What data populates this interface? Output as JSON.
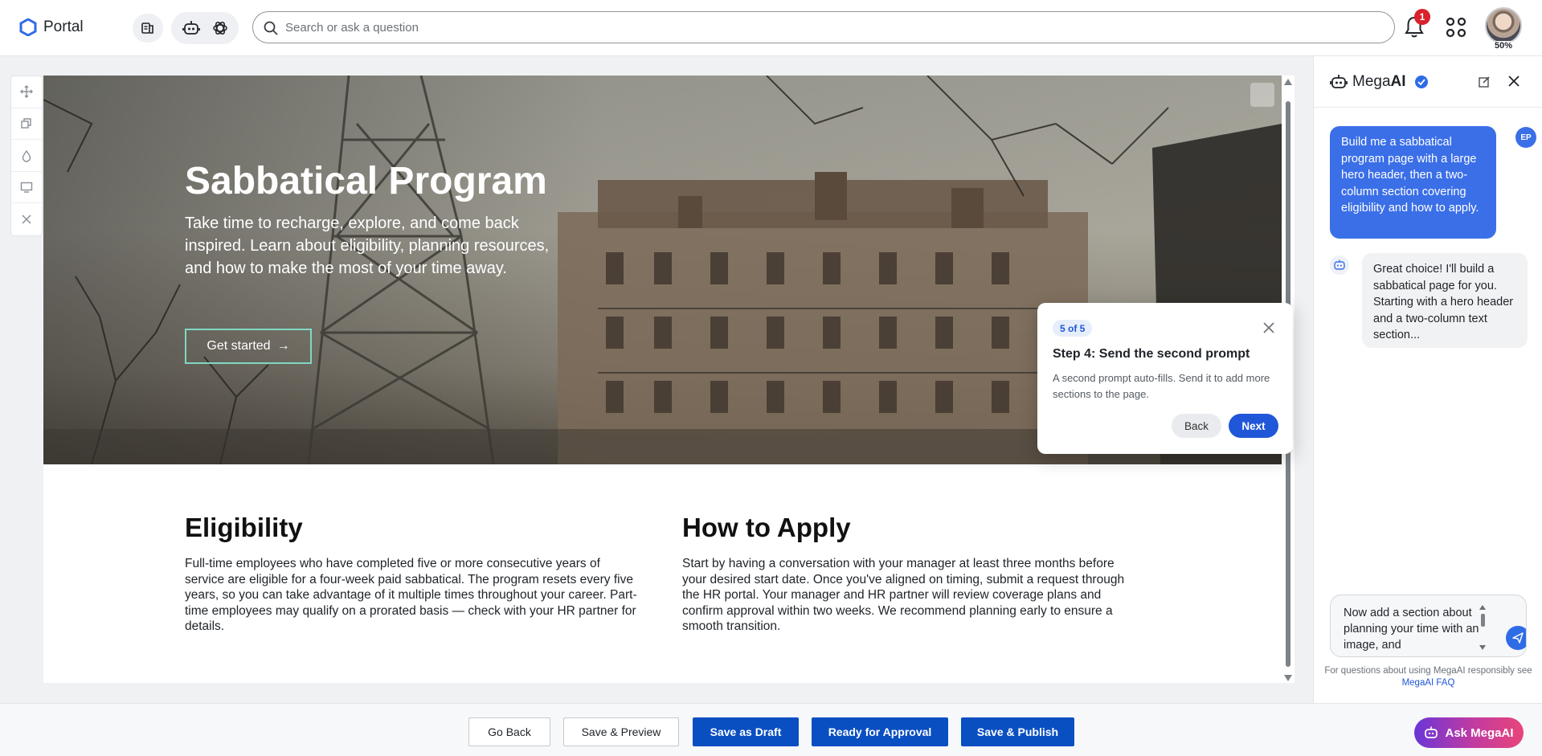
{
  "app": {
    "name": "Portal"
  },
  "search": {
    "placeholder": "Search or ask a question"
  },
  "notifications": {
    "count": "1"
  },
  "avatar": {
    "percent": "50%"
  },
  "hero": {
    "title": "Sabbatical Program",
    "subtitle": "Take time to recharge, explore, and come back inspired. Learn about eligibility, planning resources, and how to make the most of your time away.",
    "button_label": "Get started",
    "button_arrow": "→"
  },
  "eligibility": {
    "heading": "Eligibility",
    "body": "Full-time employees who have completed five or more consecutive years of service are eligible for a four-week paid sabbatical. The program resets every five years, so you can take advantage of it multiple times throughout your career. Part-time employees may qualify on a prorated basis — check with your HR partner for details."
  },
  "how_to_apply": {
    "heading": "How to Apply",
    "body": "Start by having a conversation with your manager at least three months before your desired start date. Once you've aligned on timing, submit a request through the HR portal. Your manager and HR partner will review coverage plans and confirm approval within two weeks. We recommend planning early to ensure a smooth transition."
  },
  "tour": {
    "step": "5 of 5",
    "title": "Step 4: Send the second prompt",
    "text": "A second prompt auto-fills. Send it to add more sections to the page.",
    "back_label": "Back",
    "next_label": "Next"
  },
  "assistant": {
    "name_prefix": "Mega",
    "name_bold": "AI",
    "user_initials": "EP",
    "user_message": "Build me a sabbatical program page with a large hero header, then a two-column section covering eligibility and how to apply.",
    "ai_message": "Great choice! I'll build a sabbatical page for you. Starting with a hero header and a two-column text section...",
    "input_value": "Now add a section about planning your time with an image, and",
    "note_text": "For questions about using MegaAI responsibly see",
    "note_link": "MegaAI FAQ"
  },
  "bottom": {
    "go_back": "Go Back",
    "save_preview": "Save & Preview",
    "save_draft": "Save as Draft",
    "ready_approval": "Ready for Approval",
    "save_publish": "Save & Publish",
    "ask_label": "Ask MegaAI"
  },
  "colors": {
    "primary": "#0a4fc2",
    "accent_blue": "#3b6fe8",
    "badge_red": "#d9202b",
    "hero_button_border": "#7fd8c4"
  },
  "icons": {
    "logo": "hexagon-logo-icon",
    "bell": "bell-icon",
    "apps": "apps-grid-icon",
    "search": "search-icon",
    "send": "send-icon"
  }
}
